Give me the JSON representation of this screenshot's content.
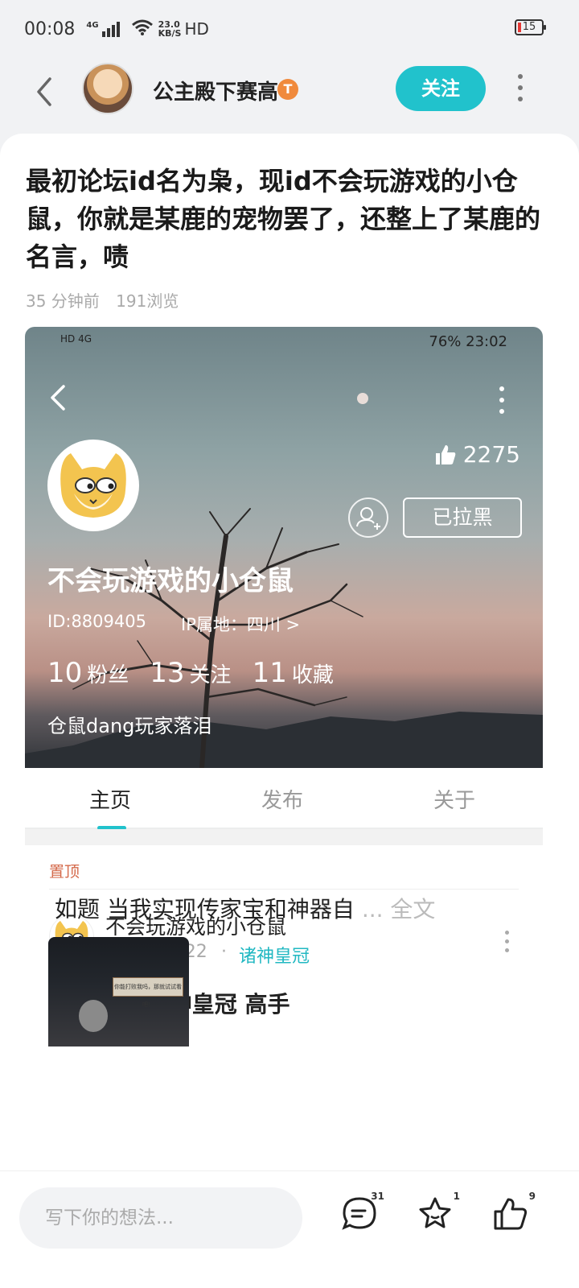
{
  "status_bar": {
    "time": "00:08",
    "network": "4G",
    "speed_top": "23.0",
    "speed_bottom": "KB/S",
    "hd": "HD",
    "battery": "15"
  },
  "header": {
    "author": "公主殿下赛高",
    "badge": "T",
    "follow_label": "关注"
  },
  "post": {
    "title": "最初论坛id名为枭，现id不会玩游戏的小仓鼠，你就是某鹿的宠物罢了，还整上了某鹿的名言，啧",
    "time": "35 分钟前",
    "views": "191浏览"
  },
  "embedded": {
    "status_left": "HD 4G",
    "status_right": "76%  23:02",
    "likes": "2275",
    "blocked_label": "已拉黑",
    "username": "不会玩游戏的小仓鼠",
    "user_id": "ID:8809405",
    "ip": "IP属地：四川 >",
    "stats": [
      {
        "num": "10",
        "label": "粉丝"
      },
      {
        "num": "13",
        "label": "关注"
      },
      {
        "num": "11",
        "label": "收藏"
      }
    ],
    "bio": "仓鼠dang玩家落泪",
    "tabs": [
      "主页",
      "发布",
      "关于"
    ],
    "pinned_label": "置顶",
    "post_author": "不会玩游戏的小仓鼠",
    "post_date": "2023/03/22",
    "post_dot": "·",
    "post_game": "诸神皇冠",
    "post_title": "我要成为 诸神皇冠 高手",
    "excerpt": "如题   当我实现传家宝和神器自",
    "excerpt_more": "... 全文",
    "thumb_text": "你能打败我吗，那就试试看吧！"
  },
  "bottom": {
    "placeholder": "写下你的想法...",
    "comments": "31",
    "favorites": "1",
    "likes": "9"
  },
  "colors": {
    "accent": "#21c2cc",
    "pinned": "#d4694a"
  }
}
